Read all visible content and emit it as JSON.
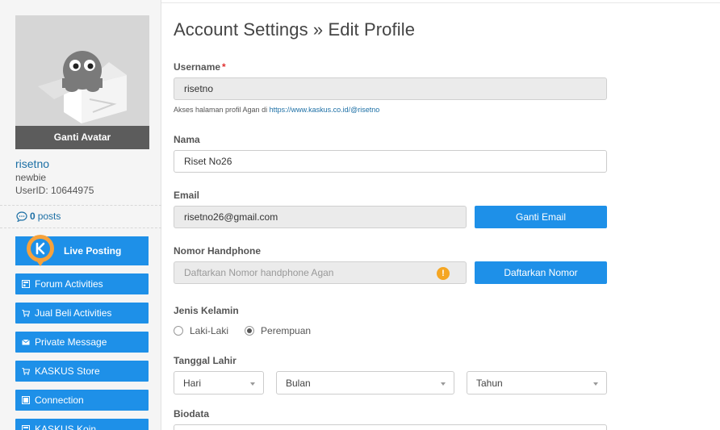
{
  "sidebar": {
    "avatar_action": "Ganti Avatar",
    "username": "risetno",
    "rank": "newbie",
    "user_id": "UserID: 10644975",
    "posts_count": "0",
    "posts_label": "posts",
    "live_posting": "Live Posting",
    "menu": [
      {
        "label": "Forum Activities",
        "icon": "forum-icon"
      },
      {
        "label": "Jual Beli Activities",
        "icon": "cart-icon"
      },
      {
        "label": "Private Message",
        "icon": "envelope-icon"
      },
      {
        "label": "KASKUS Store",
        "icon": "cart-icon"
      },
      {
        "label": "Connection",
        "icon": "connection-icon"
      },
      {
        "label": "KASKUS Koin",
        "icon": "coin-icon"
      }
    ]
  },
  "main": {
    "title": "Account Settings » Edit Profile",
    "username": {
      "label": "Username",
      "required_mark": "*",
      "value": "risetno",
      "hint_prefix": "Akses halaman profil Agan di ",
      "hint_link": "https://www.kaskus.co.id/@risetno"
    },
    "nama": {
      "label": "Nama",
      "value": "Riset No26"
    },
    "email": {
      "label": "Email",
      "value": "risetno26@gmail.com",
      "button": "Ganti Email"
    },
    "phone": {
      "label": "Nomor Handphone",
      "placeholder": "Daftarkan Nomor handphone Agan",
      "warning": "!",
      "button": "Daftarkan Nomor"
    },
    "gender": {
      "label": "Jenis Kelamin",
      "options": [
        "Laki-Laki",
        "Perempuan"
      ],
      "selected": "Perempuan"
    },
    "birthdate": {
      "label": "Tanggal Lahir",
      "day": "Hari",
      "month": "Bulan",
      "year": "Tahun"
    },
    "biodata": {
      "label": "Biodata"
    }
  },
  "colors": {
    "accent": "#1e90e8",
    "link": "#1c6fa5",
    "warning": "#f5a623",
    "required": "#e03030"
  }
}
